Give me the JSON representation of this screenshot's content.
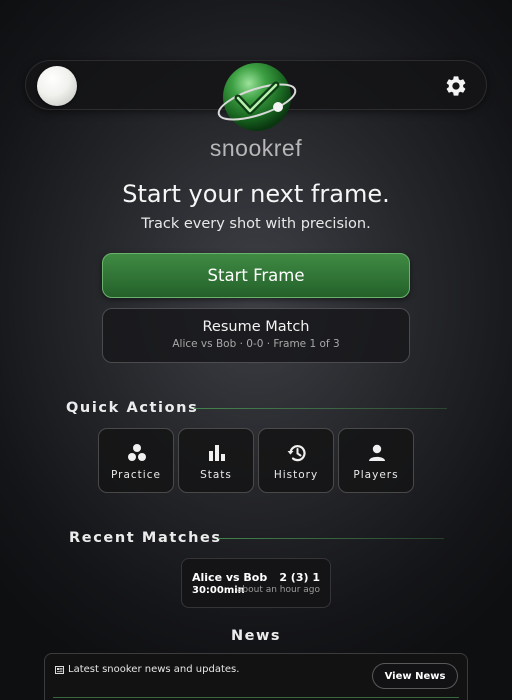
{
  "header": {
    "brand": "snookref",
    "icons": {
      "left": "cue-ball-icon",
      "logo": "snookref-logo-ball",
      "right": "gear-icon"
    }
  },
  "hero": {
    "headline": "Start your next frame.",
    "subhead": "Track every shot with precision."
  },
  "actions": {
    "start_label": "Start Frame",
    "resume_label": "Resume Match",
    "resume_detail": "Alice vs Bob · 0-0 · Frame 1 of 3"
  },
  "quick_actions": {
    "title": "Quick Actions",
    "items": [
      {
        "label": "Practice",
        "icon": "balls-icon"
      },
      {
        "label": "Stats",
        "icon": "bar-chart-icon"
      },
      {
        "label": "History",
        "icon": "history-icon"
      },
      {
        "label": "Players",
        "icon": "person-icon"
      }
    ]
  },
  "recent_matches": {
    "title": "Recent Matches",
    "items": [
      {
        "players": "Alice vs Bob",
        "score": "2 (3) 1",
        "duration": "30:00min",
        "ago": "about an hour ago"
      }
    ]
  },
  "news": {
    "title": "News",
    "text": "Latest snooker news and updates.",
    "button_label": "View News",
    "icon": "newspaper-icon"
  },
  "colors": {
    "accent_green": "#2f7a35",
    "accent_border": "#6bb36d",
    "divider_green": "#468c50"
  }
}
